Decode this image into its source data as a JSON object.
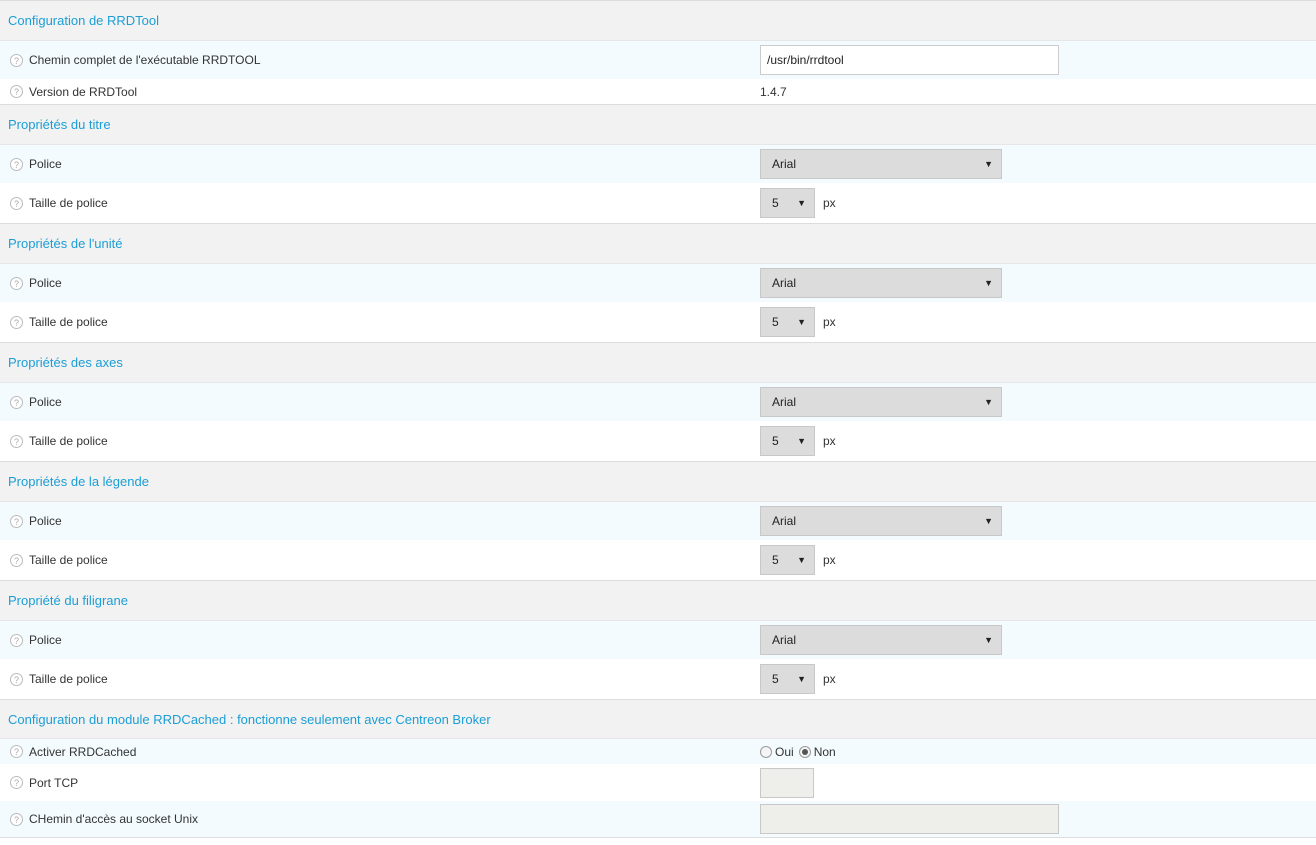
{
  "sections": {
    "rrdtool": {
      "title": "Configuration de RRDTool",
      "path_label": "Chemin complet de l'exécutable RRDTOOL",
      "path_value": "/usr/bin/rrdtool",
      "version_label": "Version de RRDTool",
      "version_value": "1.4.7"
    },
    "titre": {
      "title": "Propriétés du titre",
      "police_label": "Police",
      "police_value": "Arial",
      "taille_label": "Taille de police",
      "taille_value": "5",
      "unit": "px"
    },
    "unite": {
      "title": "Propriétés de l'unité",
      "police_label": "Police",
      "police_value": "Arial",
      "taille_label": "Taille de police",
      "taille_value": "5",
      "unit": "px"
    },
    "axes": {
      "title": "Propriétés des axes",
      "police_label": "Police",
      "police_value": "Arial",
      "taille_label": "Taille de police",
      "taille_value": "5",
      "unit": "px"
    },
    "legende": {
      "title": "Propriétés de la légende",
      "police_label": "Police",
      "police_value": "Arial",
      "taille_label": "Taille de police",
      "taille_value": "5",
      "unit": "px"
    },
    "filigrane": {
      "title": "Propriété du filigrane",
      "police_label": "Police",
      "police_value": "Arial",
      "taille_label": "Taille de police",
      "taille_value": "5",
      "unit": "px"
    },
    "rrdcached": {
      "title": "Configuration du module RRDCached : fonctionne seulement avec Centreon Broker",
      "activer_label": "Activer RRDCached",
      "oui_label": "Oui",
      "non_label": "Non",
      "selected": "Non",
      "port_label": "Port TCP",
      "port_value": "",
      "socket_label": "CHemin d'accès au socket Unix",
      "socket_value": ""
    }
  },
  "colors": {
    "section_title": "#1b9ed6",
    "section_bg": "#f2f2f2",
    "field_bg": "#f3fbfe"
  },
  "icons": {
    "help": "question-mark-circle-icon",
    "dropdown": "caret-down-icon"
  }
}
